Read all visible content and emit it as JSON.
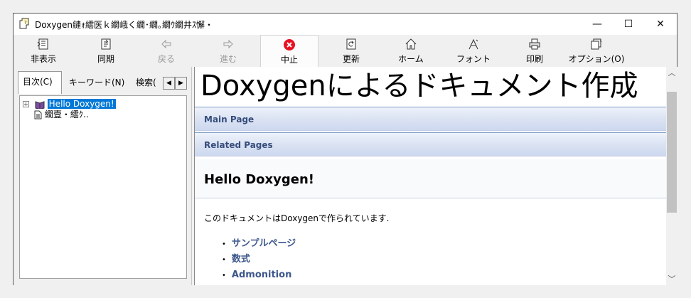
{
  "window": {
    "title": "Doxygen縺ｫ繧医ｋ繝峨く繝･繝｡繝ｳ繝井ｽ懈・",
    "minimize": "—",
    "maximize": "☐",
    "close": "✕"
  },
  "toolbar": {
    "hide": "非表示",
    "sync": "同期",
    "back": "戻る",
    "forward": "進む",
    "stop": "中止",
    "refresh": "更新",
    "home": "ホーム",
    "font": "フォント",
    "print": "印刷",
    "options": "オプション(O)"
  },
  "tabs": {
    "contents": "目次(C)",
    "keyword": "キーワード(N)",
    "search": "検索("
  },
  "tree": {
    "items": [
      {
        "label": "Hello Doxygen!",
        "selected": true,
        "expander": "+"
      },
      {
        "label": "繝壹・繧ｸ‥",
        "selected": false
      }
    ]
  },
  "content": {
    "title": "Doxygenによるドキュメント作成",
    "nav1": "Main Page",
    "nav2": "Related Pages",
    "heading": "Hello Doxygen!",
    "intro": "このドキュメントはDoxygenで作られています.",
    "links": [
      "サンプルページ",
      "数式",
      "Admonition"
    ],
    "link_color": "#3d578c"
  },
  "colors": {
    "accent": "#0078d7",
    "stop_red": "#e81123",
    "navbar_text": "#364d7c"
  }
}
